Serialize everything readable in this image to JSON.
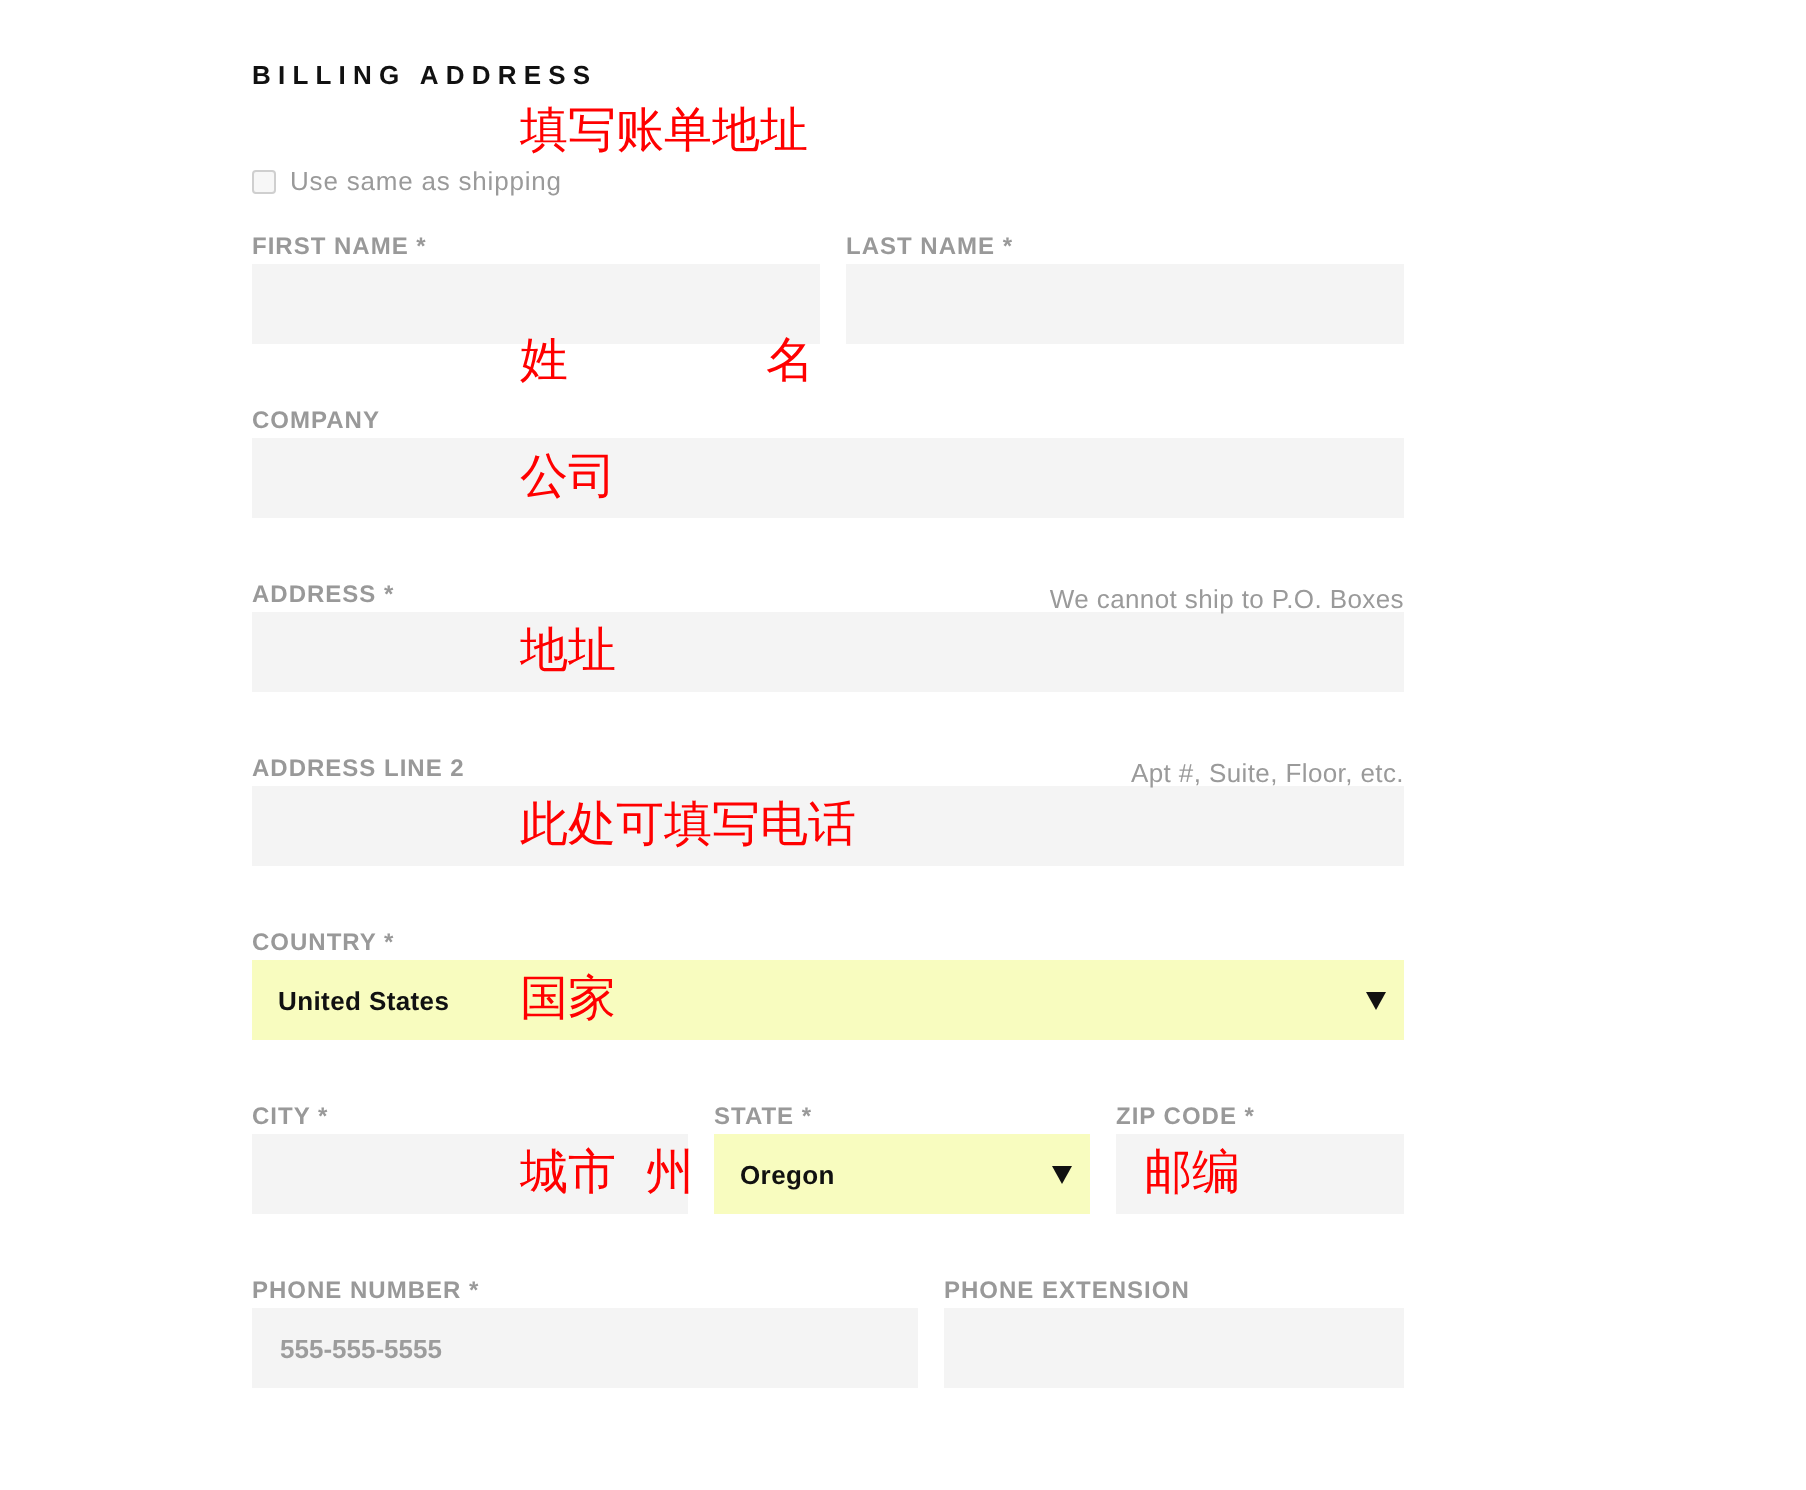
{
  "billing": {
    "title": "BILLING ADDRESS",
    "same_as_shipping": {
      "label": "Use same as shipping",
      "checked": false
    },
    "rows": [
      [
        {
          "kind": "text",
          "label": "FIRST NAME *"
        },
        {
          "kind": "text",
          "label": "LAST NAME *"
        }
      ],
      [
        {
          "kind": "text",
          "label": "COMPANY"
        }
      ],
      [
        {
          "kind": "text",
          "label": "ADDRESS *",
          "hint": "We cannot ship to P.O. Boxes"
        }
      ],
      [
        {
          "kind": "text",
          "label": "ADDRESS LINE 2",
          "hint": "Apt #, Suite, Floor, etc."
        }
      ],
      [
        {
          "kind": "select",
          "label": "COUNTRY *",
          "value": "United States"
        }
      ],
      [
        {
          "kind": "text",
          "label": "CITY *"
        },
        {
          "kind": "select",
          "label": "STATE *",
          "value": "Oregon"
        },
        {
          "kind": "text",
          "label": "ZIP CODE *"
        }
      ],
      [
        {
          "kind": "text",
          "label": "PHONE NUMBER *",
          "placeholder": "555-555-5555"
        },
        {
          "kind": "text",
          "label": "PHONE EXTENSION"
        }
      ]
    ]
  },
  "annotations": [
    {
      "text": "填写账单地址"
    },
    {
      "text": "姓"
    },
    {
      "text": "名"
    },
    {
      "text": "公司"
    },
    {
      "text": "地址"
    },
    {
      "text": "此处可填写电话"
    },
    {
      "text": "国家"
    },
    {
      "text": "城市"
    },
    {
      "text": "州"
    },
    {
      "text": "邮编"
    }
  ]
}
